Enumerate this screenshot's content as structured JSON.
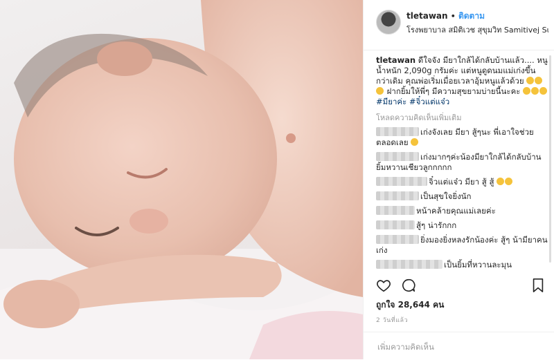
{
  "header": {
    "username": "tletawan",
    "separator": "•",
    "follow_label": "ติดตาม",
    "location": "โรงพยาบาล สมิติเวช สุขุมวิท Samitivej Sukh..."
  },
  "caption": {
    "username": "tletawan",
    "text": "ดีใจจัง มียาใกล้ได้กลับบ้านแล้ว.... หนูน้ำหนัก 2,090g กรัมค่ะ แต่หนูดูดนมแม่เก่งขึ้นกว่าเดิม คุณพ่อเริ่มเมื่อยเวลาอุ้มหนูแล้วด้วย",
    "text2": "ฝากยิ้มให้พี่ๆ มีความสุขยามบ่ายนี้นะคะ",
    "hashtags": "#มียาค่ะ #จิ๋วแต่แจ๋ว"
  },
  "load_more": "โหลดความคิดเห็นเพิ่มเติม",
  "comments": [
    {
      "text": "เก่งจังเลย มียา สู้ๆนะ พี่เอาใจช่วยตลอดเลย"
    },
    {
      "text": "เก่งมากๆค่ะน้องมียาใกล้ได้กลับบ้านยิ้มหวานเชียวลูกกกกก"
    },
    {
      "text": "จิ๋วแต่แจ๋ว มียา สู้ สู้"
    },
    {
      "text": "เป็นสุขใจยิ่งนัก"
    },
    {
      "text": "หน้าคล้ายคุณแม่เลยค่ะ"
    },
    {
      "text": "สู้ๆ น่ารักกก"
    },
    {
      "text": "ยิ่งมองยิ่งหลงรักน้องค่ะ สู้ๆ น้ามียาคนเก่ง"
    },
    {
      "text": "เป็นยิ้มที่หวานละมุน"
    }
  ],
  "likes": "ถูกใจ 28,644 คน",
  "timestamp": "2 วันที่แล้ว",
  "add_comment_placeholder": "เพิ่มความคิดเห็น",
  "colors": {
    "accent": "#3897f0",
    "text": "#262626",
    "muted": "#999999",
    "hashtag": "#003569"
  }
}
